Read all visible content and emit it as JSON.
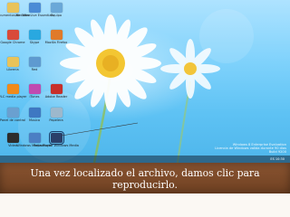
{
  "desktop_icons": [
    {
      "label": "Documentos de Office",
      "icon": "folder-icon",
      "color": "#e8c35a"
    },
    {
      "label": "Windows Live Essentials",
      "icon": "app-icon",
      "color": "#4a8bd6"
    },
    {
      "label": "Equipo",
      "icon": "computer-icon",
      "color": "#6aa8d8"
    },
    {
      "label": "Google Chrome",
      "icon": "chrome-icon",
      "color": "#d94a3a"
    },
    {
      "label": "Skype",
      "icon": "skype-icon",
      "color": "#29a8e0"
    },
    {
      "label": "Mozilla Firefox",
      "icon": "firefox-icon",
      "color": "#e07a2a"
    },
    {
      "label": "Libreria",
      "icon": "folder-icon",
      "color": "#e8c35a"
    },
    {
      "label": "Red",
      "icon": "network-icon",
      "color": "#5e9ad0"
    },
    {
      "label": "VLC media player",
      "icon": "vlc-icon",
      "color": "#f08a1a"
    },
    {
      "label": "iTunes",
      "icon": "itunes-icon",
      "color": "#c04ab0"
    },
    {
      "label": "Adobe Reader",
      "icon": "pdf-icon",
      "color": "#c8302a"
    },
    {
      "label": "Panel de control",
      "icon": "control-panel-icon",
      "color": "#6aa0d0"
    },
    {
      "label": "Musica",
      "icon": "music-icon",
      "color": "#3e78c2"
    },
    {
      "label": "Papelera",
      "icon": "recycle-bin-icon",
      "color": "#9db8cc"
    },
    {
      "label": "Video",
      "icon": "video-icon",
      "color": "#2d2d2d"
    },
    {
      "label": "Windows Media Player",
      "icon": "wmp-icon",
      "color": "#4b7fc4"
    },
    {
      "label": "Reproductor Windows Media",
      "icon": "media-file-icon",
      "color": "#2a3f6a"
    }
  ],
  "watermark": {
    "line1": "Windows 8 Enterprise Evaluation",
    "line2": "Licencia de Windows valida durante 90 dias",
    "line3": "Build 9200"
  },
  "taskbar": {
    "tray_text": "ES 10:30"
  },
  "caption": "Una vez localizado el archivo, damos clic para reproducirlo."
}
